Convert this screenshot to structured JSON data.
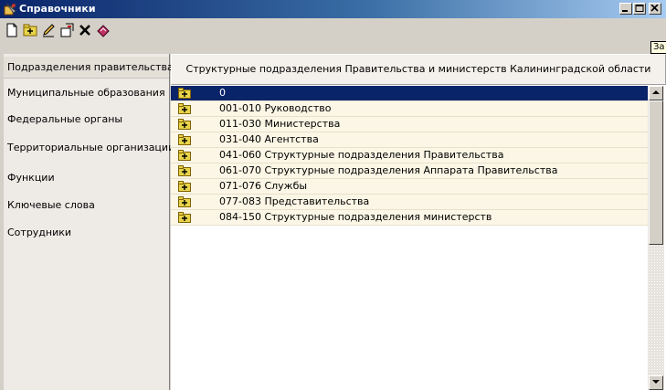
{
  "window": {
    "title": "Справочники"
  },
  "toolbar": {
    "buttons": [
      {
        "icon": "new-document-icon"
      },
      {
        "icon": "add-folder-icon"
      },
      {
        "icon": "edit-pencil-icon"
      },
      {
        "icon": "properties-icon"
      },
      {
        "icon": "delete-icon"
      },
      {
        "icon": "book-icon"
      }
    ],
    "tooltip": "За"
  },
  "sidebar": {
    "items": [
      {
        "label": "Подразделения правительства",
        "active": true
      },
      {
        "label": "Муниципальные образования"
      },
      {
        "label": "Федеральные органы"
      },
      {
        "label": "Территориальные организации"
      },
      {
        "label": "Функции"
      },
      {
        "label": "Ключевые слова"
      },
      {
        "label": "Сотрудники"
      }
    ]
  },
  "panel": {
    "header": "Структурные подразделения Правительства и министерств Калининградской области",
    "rows": [
      {
        "label": "0",
        "selected": true
      },
      {
        "label": "001-010  Руководство"
      },
      {
        "label": "011-030  Министерства"
      },
      {
        "label": "031-040  Агентства"
      },
      {
        "label": "041-060  Структурные подразделения Правительства"
      },
      {
        "label": "061-070  Структурные подразделения Аппарата Правительства"
      },
      {
        "label": "071-076  Службы"
      },
      {
        "label": "077-083  Представительства"
      },
      {
        "label": "084-150  Структурные подразделения министерств"
      }
    ]
  },
  "colors": {
    "titlebar_start": "#0a246a",
    "selection": "#0a246a",
    "row_bg": "#fbf6e5",
    "folder": "#e8d44a"
  }
}
